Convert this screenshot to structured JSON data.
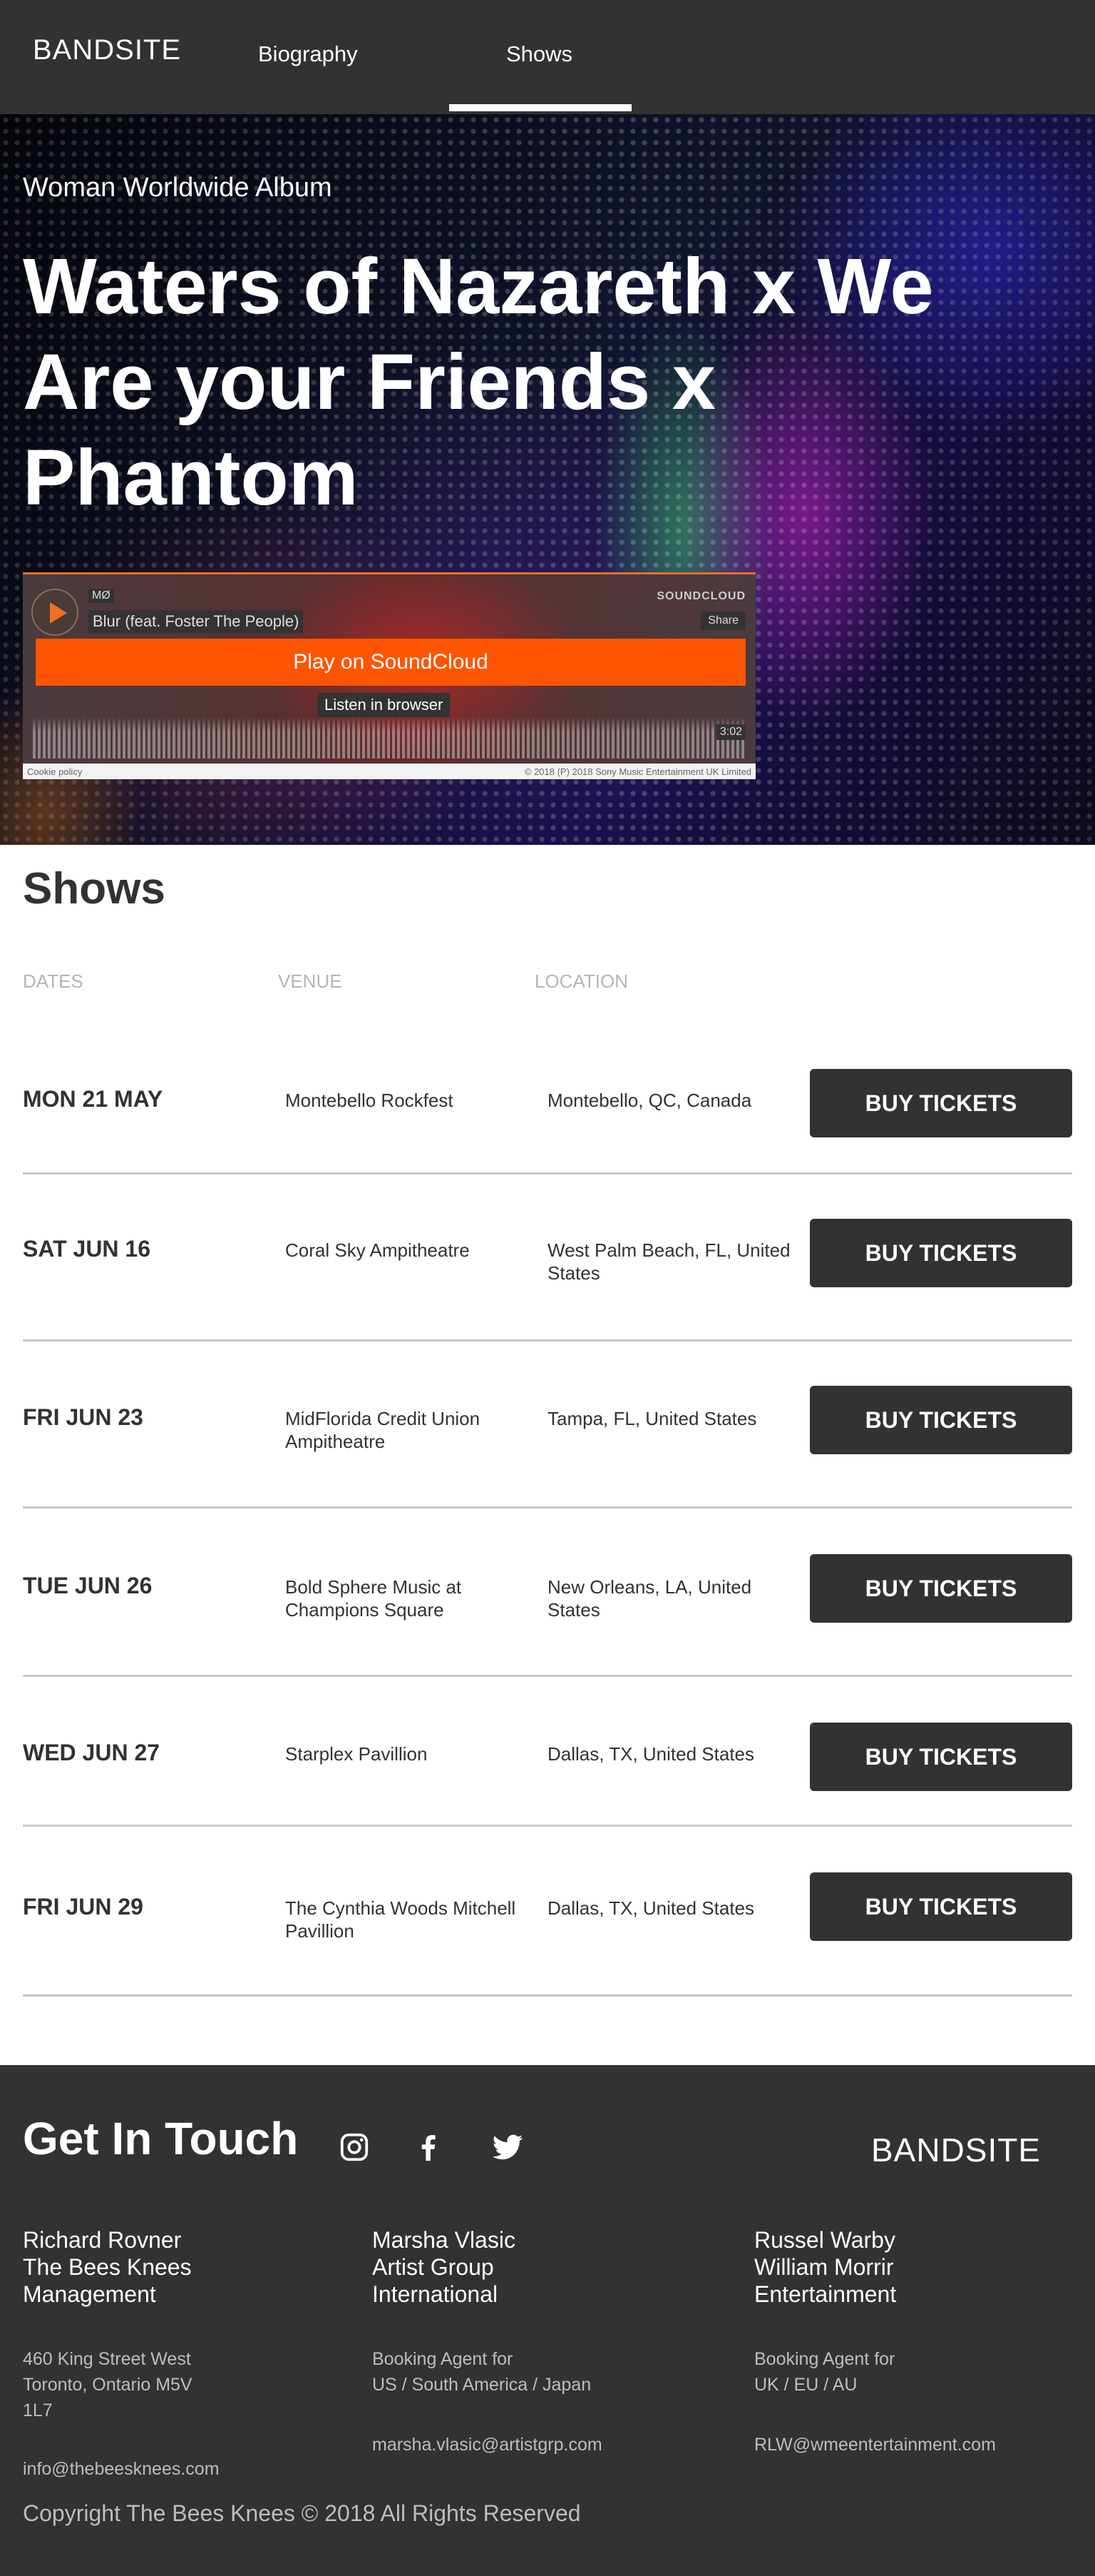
{
  "nav": {
    "logo": "BANDSITE",
    "links": [
      {
        "label": "Biography",
        "active": false
      },
      {
        "label": "Shows",
        "active": true
      }
    ]
  },
  "hero": {
    "subtitle": "Woman Worldwide Album",
    "title": "Waters of Nazareth x We Are your Friends x Phantom",
    "player": {
      "artist": "MØ",
      "track": "Blur (feat. Foster The People)",
      "brand": "SOUNDCLOUD",
      "share_label": "Share",
      "play_button": "Play on SoundCloud",
      "browser_button": "Listen in browser",
      "duration": "3:02",
      "cookie_policy": "Cookie policy",
      "copyright": "© 2018 (P) 2018 Sony Music Entertainment UK Limited"
    }
  },
  "shows": {
    "title": "Shows",
    "columns": {
      "dates": "DATES",
      "venue": "VENUE",
      "location": "LOCATION"
    },
    "buy_label": "BUY TICKETS",
    "rows": [
      {
        "date": "MON 21 MAY",
        "venue": "Montebello Rockfest",
        "location": "Montebello, QC, Canada"
      },
      {
        "date": "SAT JUN 16",
        "venue": "Coral Sky Ampitheatre",
        "location": "West Palm Beach, FL, United States"
      },
      {
        "date": "FRI JUN 23",
        "venue": "MidFlorida Credit Union Ampitheatre",
        "location": "Tampa, FL, United States"
      },
      {
        "date": "TUE JUN 26",
        "venue": "Bold Sphere Music at Champions Square",
        "location": "New Orleans, LA, United States"
      },
      {
        "date": "WED JUN 27",
        "venue": "Starplex Pavillion",
        "location": "Dallas, TX, United States"
      },
      {
        "date": "FRI JUN 29",
        "venue": "The Cynthia Woods Mitchell Pavillion",
        "location": "Dallas, TX, United States"
      }
    ]
  },
  "footer": {
    "title": "Get In Touch",
    "logo": "BANDSITE",
    "social_icons": [
      "instagram-icon",
      "facebook-icon",
      "twitter-icon"
    ],
    "contacts": [
      {
        "name": [
          "Richard Rovner",
          "The Bees Knees",
          "Management"
        ],
        "details": [
          "460 King Street West",
          "Toronto, Ontario M5V",
          "1L7"
        ],
        "email": "info@thebeesknees.com"
      },
      {
        "name": [
          "Marsha Vlasic",
          "Artist Group",
          "International"
        ],
        "details": [
          "Booking Agent for",
          "US / South America / Japan"
        ],
        "email": "marsha.vlasic@artistgrp.com"
      },
      {
        "name": [
          "Russel Warby",
          "William Morrir",
          "Entertainment"
        ],
        "details": [
          "Booking Agent for",
          "UK / EU / AU"
        ],
        "email": "RLW@wmeentertainment.com"
      }
    ],
    "copyright": "Copyright The Bees Knees © 2018 All Rights Reserved"
  }
}
